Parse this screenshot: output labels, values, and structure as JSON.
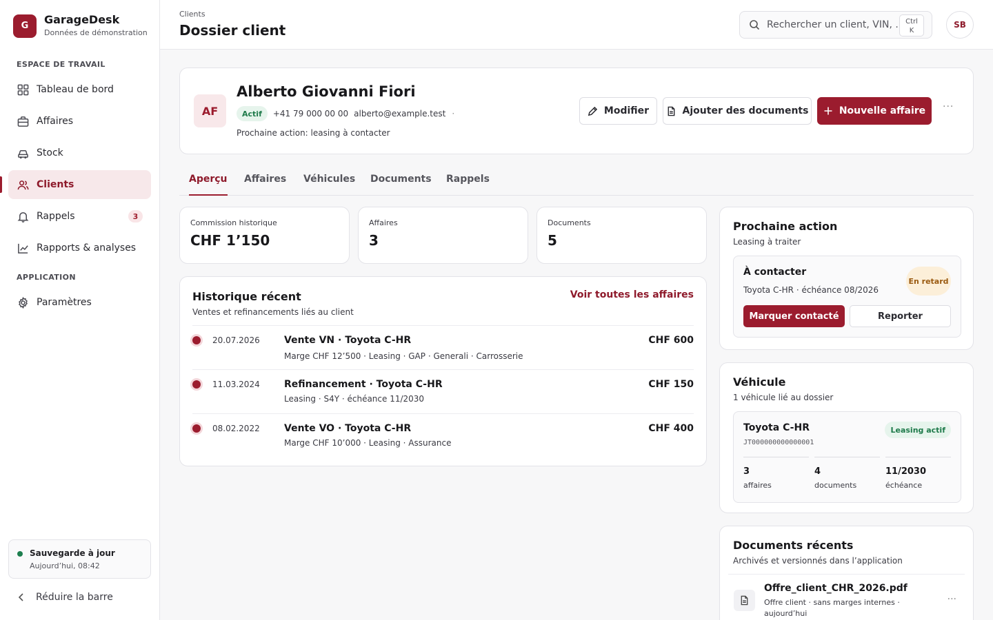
{
  "app": {
    "logo_letter": "G",
    "name": "GarageDesk",
    "subtitle": "Données de démonstration"
  },
  "sidebar": {
    "section_workspace": "ESPACE DE TRAVAIL",
    "section_app": "APPLICATION",
    "items": [
      {
        "label": "Tableau de bord",
        "icon": "grid-icon"
      },
      {
        "label": "Affaires",
        "icon": "briefcase-icon"
      },
      {
        "label": "Stock",
        "icon": "car-icon"
      },
      {
        "label": "Clients",
        "icon": "users-icon",
        "active": true
      },
      {
        "label": "Rappels",
        "icon": "bell-icon",
        "badge": "3"
      },
      {
        "label": "Rapports & analyses",
        "icon": "chart-icon"
      },
      {
        "label": "Paramètres",
        "icon": "gear-icon"
      }
    ],
    "save_status": {
      "title": "Sauvegarde à jour",
      "time": "Aujourd’hui, 08:42",
      "color": "#1e7f4f"
    },
    "collapse_label": "Réduire la barre"
  },
  "header": {
    "breadcrumb": "Clients",
    "title": "Dossier client",
    "search_placeholder": "Rechercher un client, VIN, ...",
    "shortcut_line1": "Ctrl",
    "shortcut_line2": "K",
    "user_initials": "SB"
  },
  "client": {
    "initials": "AF",
    "name": "Alberto Giovanni Fiori",
    "status": "Actif",
    "phone": "+41 79 000 00 00",
    "email": "alberto@example.test",
    "dot": "·",
    "next_action": "Prochaine action: leasing à contacter",
    "actions": {
      "edit": "Modifier",
      "add_docs": "Ajouter des documents",
      "new_deal": "Nouvelle affaire"
    },
    "more": "···"
  },
  "tabs": [
    {
      "label": "Aperçu",
      "active": true
    },
    {
      "label": "Affaires"
    },
    {
      "label": "Véhicules"
    },
    {
      "label": "Documents"
    },
    {
      "label": "Rappels"
    }
  ],
  "stats": [
    {
      "label": "Commission historique",
      "value": "CHF 1’150"
    },
    {
      "label": "Affaires",
      "value": "3"
    },
    {
      "label": "Documents",
      "value": "5"
    }
  ],
  "history": {
    "title": "Historique récent",
    "subtitle": "Ventes et refinancements liés au client",
    "link": "Voir toutes les affaires",
    "rows": [
      {
        "date": "20.07.2026",
        "title": "Vente VN · Toyota C-HR",
        "desc": "Marge CHF 12’500 · Leasing · GAP · Generali · Carrosserie",
        "amount": "CHF 600"
      },
      {
        "date": "11.03.2024",
        "title": "Refinancement · Toyota C-HR",
        "desc": "Leasing · S4Y · échéance 11/2030",
        "amount": "CHF 150"
      },
      {
        "date": "08.02.2022",
        "title": "Vente VO · Toyota C-HR",
        "desc": "Marge CHF 10’000 · Leasing · Assurance",
        "amount": "CHF 400"
      }
    ]
  },
  "next_action": {
    "title": "Prochaine action",
    "subtitle": "Leasing à traiter",
    "task_title": "À contacter",
    "task_desc": "Toyota C-HR · échéance 08/2026",
    "badge": "En retard",
    "primary": "Marquer contacté",
    "secondary": "Reporter"
  },
  "vehicle": {
    "title": "Véhicule",
    "subtitle": "1 véhicule lié au dossier",
    "name": "Toyota C-HR",
    "vin": "JT000000000000001",
    "badge": "Leasing actif",
    "stats": [
      {
        "value": "3",
        "label": "affaires"
      },
      {
        "value": "4",
        "label": "documents"
      },
      {
        "value": "11/2030",
        "label": "échéance"
      }
    ]
  },
  "documents": {
    "title": "Documents récents",
    "subtitle": "Archivés et versionnés dans l’application",
    "items": [
      {
        "name": "Offre_client_CHR_2026.pdf",
        "desc": "Offre client · sans marges internes · aujourd’hui"
      }
    ]
  },
  "colors": {
    "accent": "#9b1c2e",
    "success": "#1e7a4a",
    "warning": "#9a5a10"
  }
}
